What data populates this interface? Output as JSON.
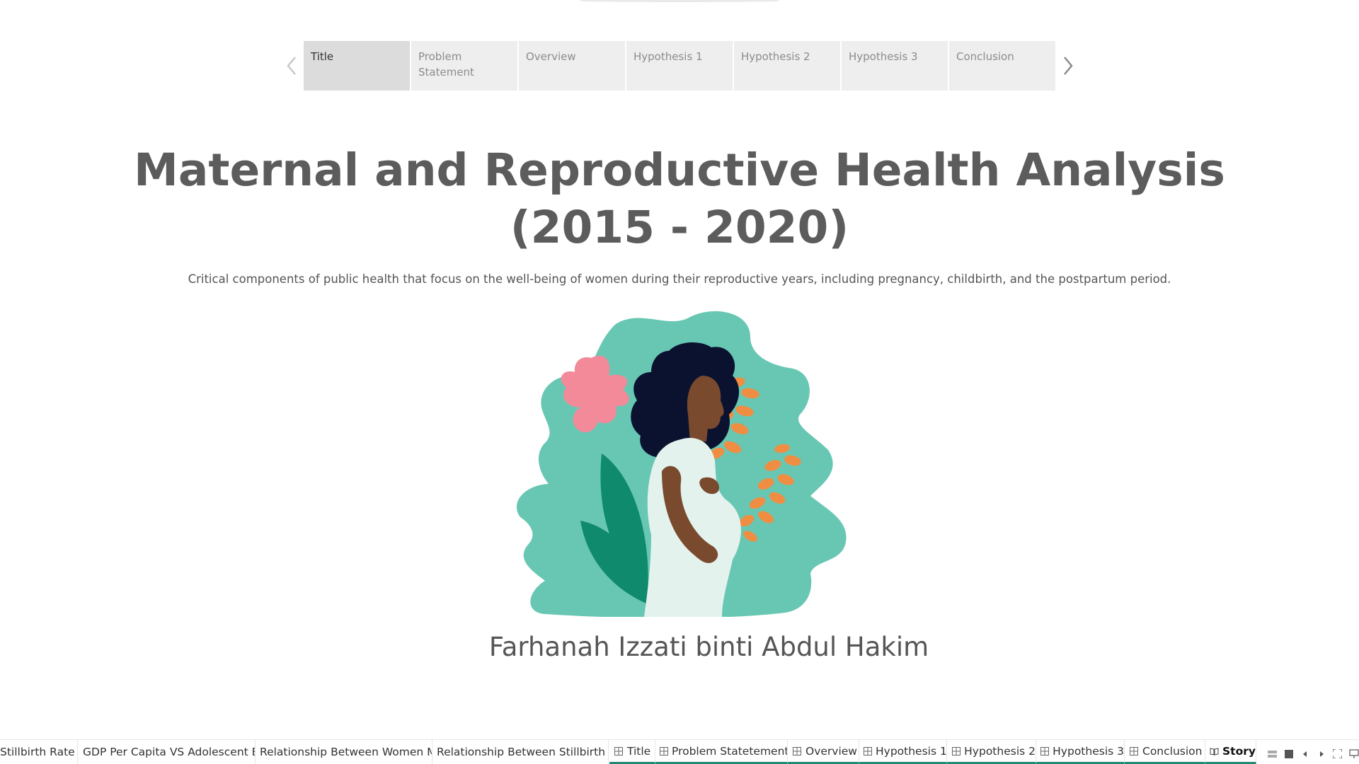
{
  "story": {
    "points": [
      {
        "label": "Title"
      },
      {
        "label": "Problem\nStatement"
      },
      {
        "label": "Overview"
      },
      {
        "label": "Hypothesis 1"
      },
      {
        "label": "Hypothesis 2"
      },
      {
        "label": "Hypothesis 3"
      },
      {
        "label": "Conclusion"
      }
    ],
    "active_index": 0,
    "prev_icon": "chevron-left-icon",
    "next_icon": "chevron-right-icon"
  },
  "content": {
    "title": "Maternal and Reproductive Health Analysis\n(2015 - 2020)",
    "subtitle": "Critical components of public health that focus on the well-being of women during their reproductive years, including pregnancy, childbirth, and the postpartum period.",
    "illustration": "pregnant-woman-illustration",
    "author": "Farhanah Izzati binti Abdul Hakim"
  },
  "tabs": [
    {
      "label": "Stillbirth Rate",
      "icon": ""
    },
    {
      "label": "GDP Per Capita VS Adolescent B...",
      "icon": ""
    },
    {
      "label": "Relationship Between Women M...",
      "icon": ""
    },
    {
      "label": "Relationship Between Stillbirth ...",
      "icon": ""
    },
    {
      "label": "Title",
      "icon": "dashboard-icon"
    },
    {
      "label": "Problem Statetement",
      "icon": "dashboard-icon"
    },
    {
      "label": "Overview",
      "icon": "dashboard-icon"
    },
    {
      "label": "Hypothesis 1",
      "icon": "dashboard-icon"
    },
    {
      "label": "Hypothesis 2",
      "icon": "dashboard-icon"
    },
    {
      "label": "Hypothesis 3",
      "icon": "dashboard-icon"
    },
    {
      "label": "Conclusion",
      "icon": "dashboard-icon"
    },
    {
      "label": "Story",
      "icon": "story-icon"
    }
  ],
  "colors": {
    "accent": "#1f8a70",
    "teal": "#68c7b3",
    "dark_teal": "#0f8a6c",
    "pink": "#f28a9a",
    "orange": "#ef8e43",
    "skin": "#7a4a2e",
    "hair": "#0b1230",
    "dress": "#e3f2ed"
  },
  "bottom_controls": [
    "sheet-sorter-icon",
    "filmstrip-icon",
    "prev-sheet-icon",
    "next-sheet-icon",
    "fullscreen-icon",
    "presentation-icon"
  ]
}
